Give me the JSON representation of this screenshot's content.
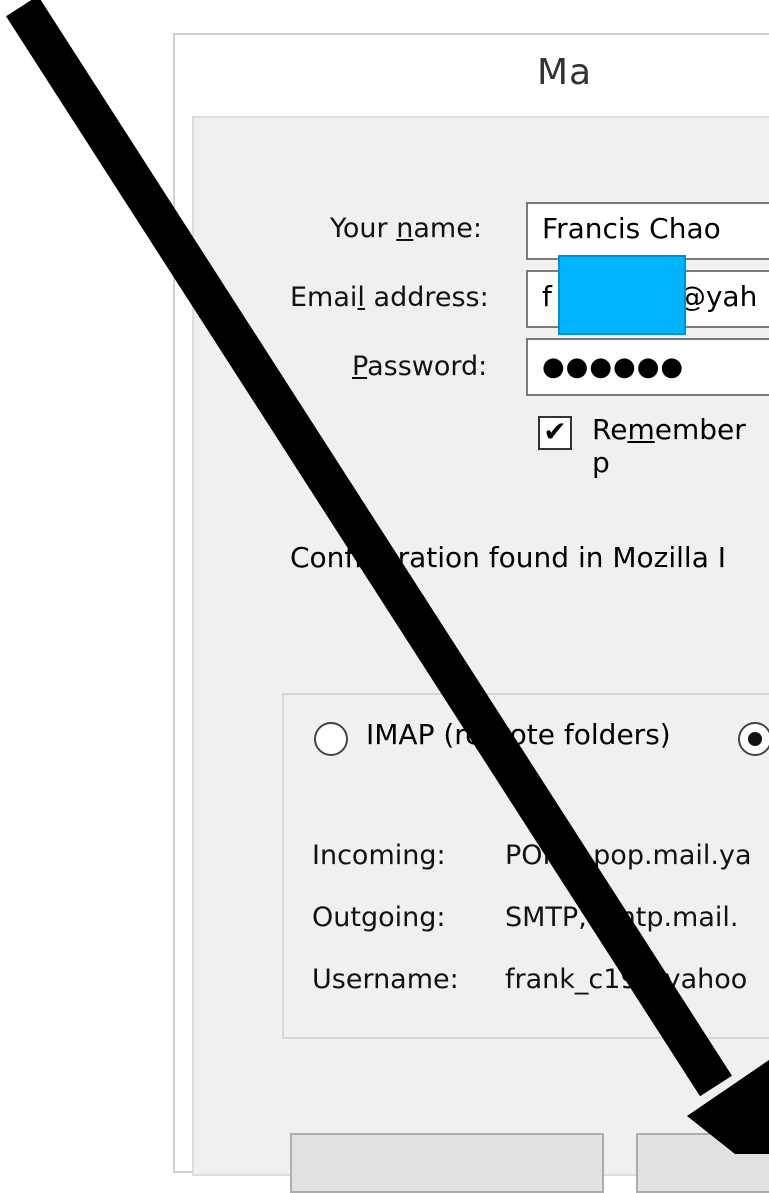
{
  "window": {
    "title": "Ma"
  },
  "form": {
    "name_label_pre": "Your ",
    "name_label_key": "n",
    "name_label_post": "ame:",
    "name_value": "Francis Chao",
    "email_label_pre": "Emai",
    "email_label_key": "l",
    "email_label_post": " address:",
    "email_value_start": "f",
    "email_value_end": "@yah",
    "password_label_key": "P",
    "password_label_post": "assword:",
    "password_value": "●●●●●●",
    "remember_pre": "Re",
    "remember_key": "m",
    "remember_post": "ember p",
    "remember_checked": true,
    "check_glyph": "✔"
  },
  "config_message": "Configuration found in Mozilla I",
  "protocol": {
    "imap_label": "IMAP (remote folders)",
    "pop_selected": true
  },
  "details": {
    "incoming_label": "Incoming:",
    "incoming_value": "POP3, pop.mail.ya",
    "outgoing_label": "Outgoing:",
    "outgoing_value": "SMTP, smtp.mail.",
    "username_label": "Username:",
    "username_value": "frank_c19@yahoo"
  },
  "buttons": {
    "left_label": "",
    "right_label": ""
  },
  "annotation": {
    "arrow_color": "#000000",
    "redaction_color": "#00b4ff"
  }
}
